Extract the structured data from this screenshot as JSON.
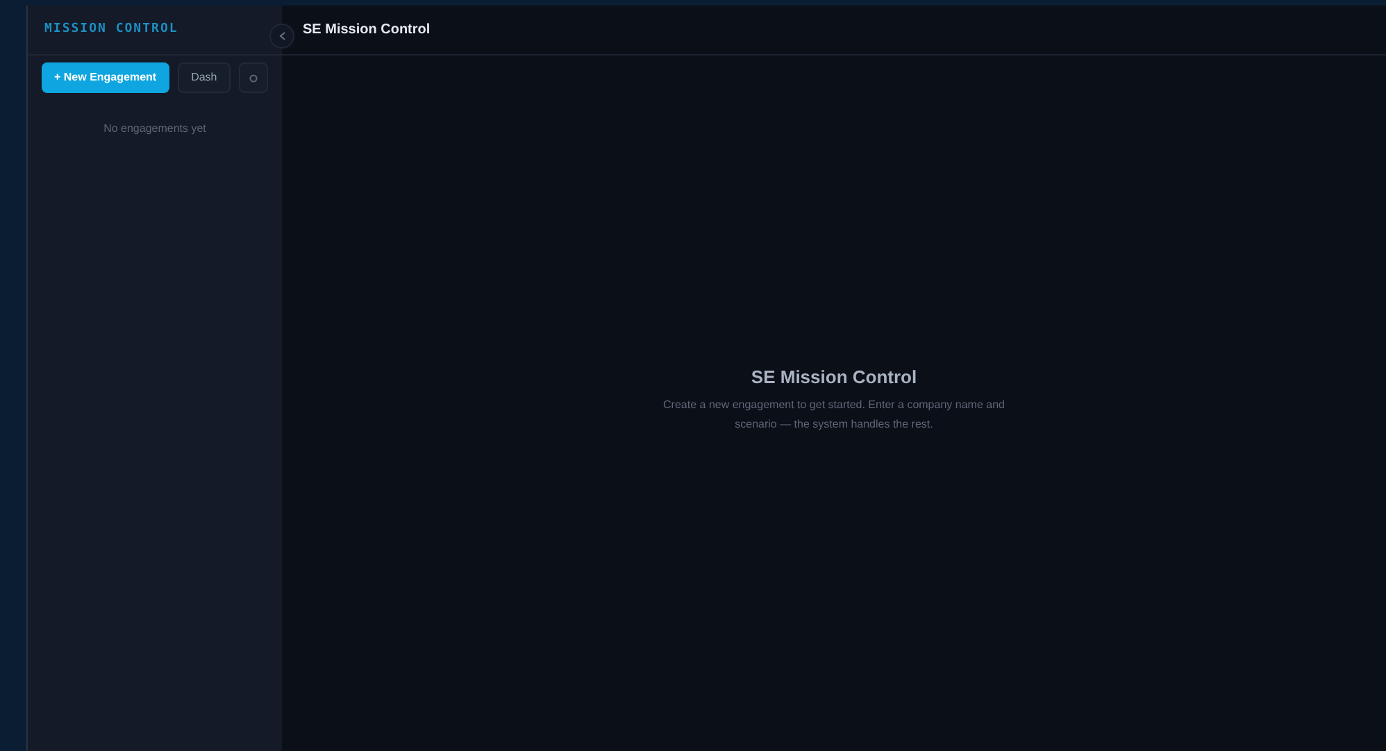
{
  "sidebar": {
    "title": "MISSION CONTROL",
    "buttons": [
      {
        "kind": "primary",
        "label": "+ New Engagement"
      },
      {
        "kind": "secondary",
        "label": "Dash"
      },
      {
        "kind": "settings"
      }
    ],
    "empty_text": "No engagements yet"
  },
  "header": {
    "title": "SE Mission Control"
  },
  "empty_state": {
    "title": "SE Mission Control",
    "message": "Create a new engagement to get started. Enter a company name and scenario — the system handles the rest."
  }
}
